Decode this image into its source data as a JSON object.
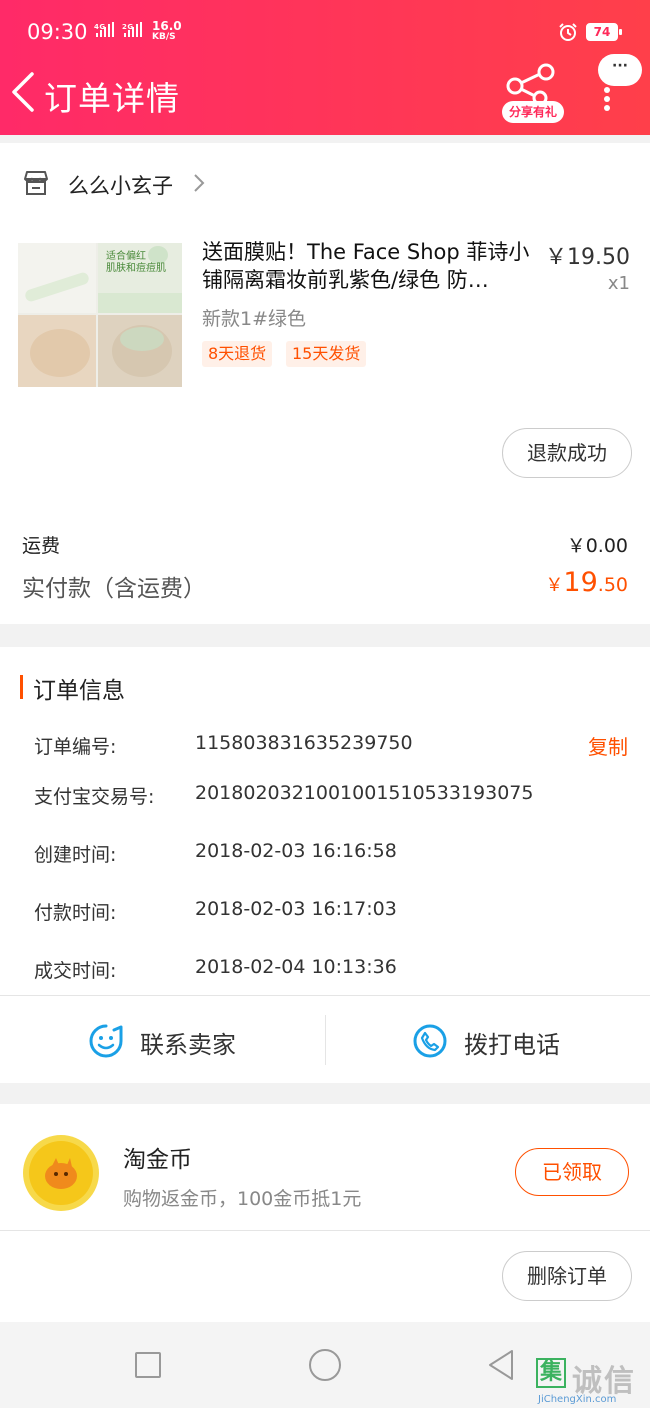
{
  "status_bar": {
    "time": "09:30",
    "signal": "4G     2G",
    "speed_value": "16.0",
    "speed_unit": "KB/S",
    "battery": "74"
  },
  "header": {
    "title": "订单详情",
    "share_label": "分享有礼",
    "more_label": "···"
  },
  "shop": {
    "name": "么么小玄子"
  },
  "product": {
    "image_text": "适合偏红\n肌肤和痘痘肌",
    "title": "送面膜贴！The Face Shop 菲诗小铺隔离霜妆前乳紫色/绿色 防…",
    "price": "￥19.50",
    "quantity": "x1",
    "sku": "新款1#绿色",
    "tags": [
      "8天退货",
      "15天发货"
    ],
    "refund_status": "退款成功"
  },
  "summary": {
    "shipping_label": "运费",
    "shipping_value": "￥0.00",
    "paid_label": "实付款（含运费）",
    "paid_symbol": "￥",
    "paid_int": "19",
    "paid_dec": ".50"
  },
  "order_info": {
    "section_title": "订单信息",
    "copy_label": "复制",
    "rows": [
      {
        "label": "订单编号:",
        "value": "115803831635239750"
      },
      {
        "label": "支付宝交易号:",
        "value": "2018020321001001510533193075"
      },
      {
        "label": "创建时间:",
        "value": "2018-02-03 16:16:58"
      },
      {
        "label": "付款时间:",
        "value": "2018-02-03 16:17:03"
      },
      {
        "label": "成交时间:",
        "value": "2018-02-04 10:13:36"
      }
    ]
  },
  "contact": {
    "seller_label": "联系卖家",
    "call_label": "拨打电话"
  },
  "coin": {
    "title": "淘金币",
    "subtitle": "购物返金币，100金币抵1元",
    "button": "已领取"
  },
  "actions": {
    "delete_label": "删除订单"
  },
  "watermark": {
    "char": "集",
    "text": "诚信",
    "url": "JiChengXin.com"
  },
  "colors": {
    "header_start": "#ff2a68",
    "header_end": "#ff3f4a",
    "accent": "#ff5000",
    "contact_icon": "#1aa0e6",
    "coin": "#f5c71a"
  }
}
